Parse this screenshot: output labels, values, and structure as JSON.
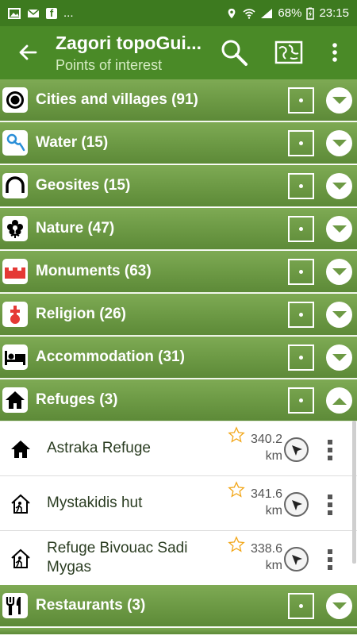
{
  "status_bar": {
    "dots": "...",
    "battery": "68%",
    "time": "23:15",
    "facebook_letter": "f"
  },
  "app_bar": {
    "title": "Zagori topoGui...",
    "subtitle": "Points of interest",
    "icons": [
      "back-arrow-icon",
      "search-icon",
      "map-icon",
      "overflow-menu-icon"
    ]
  },
  "categories": [
    {
      "label": "Cities and villages (91)",
      "icon": "target-circle-icon",
      "expanded": false
    },
    {
      "label": "Water (15)",
      "icon": "water-pin-icon",
      "expanded": false
    },
    {
      "label": "Geosites (15)",
      "icon": "arch-icon",
      "expanded": false
    },
    {
      "label": "Nature (47)",
      "icon": "flower-icon",
      "expanded": false
    },
    {
      "label": "Monuments (63)",
      "icon": "castle-wall-icon",
      "expanded": false
    },
    {
      "label": "Religion (26)",
      "icon": "cross-icon",
      "expanded": false
    },
    {
      "label": "Accommodation (31)",
      "icon": "bed-icon",
      "expanded": false
    },
    {
      "label": "Refuges (3)",
      "icon": "house-icon",
      "expanded": true
    },
    {
      "label": "Restaurants (3)",
      "icon": "fork-knife-icon",
      "expanded": false
    }
  ],
  "refuge_items": [
    {
      "name": "Astraka Refuge",
      "distance_value": "340.2",
      "distance_unit": "km",
      "icon": "house-icon"
    },
    {
      "name": "Mystakidis hut",
      "distance_value": "341.6",
      "distance_unit": "km",
      "icon": "hut-icon"
    },
    {
      "name": "Refuge Bivouac Sadi Mygas",
      "distance_value": "338.6",
      "distance_unit": "km",
      "icon": "hut-icon"
    }
  ],
  "colors": {
    "status_bar": "#3d7a1f",
    "app_bar": "#4a8a27",
    "category_row": "#6d9a45",
    "subtitle": "#d6ecc4"
  }
}
